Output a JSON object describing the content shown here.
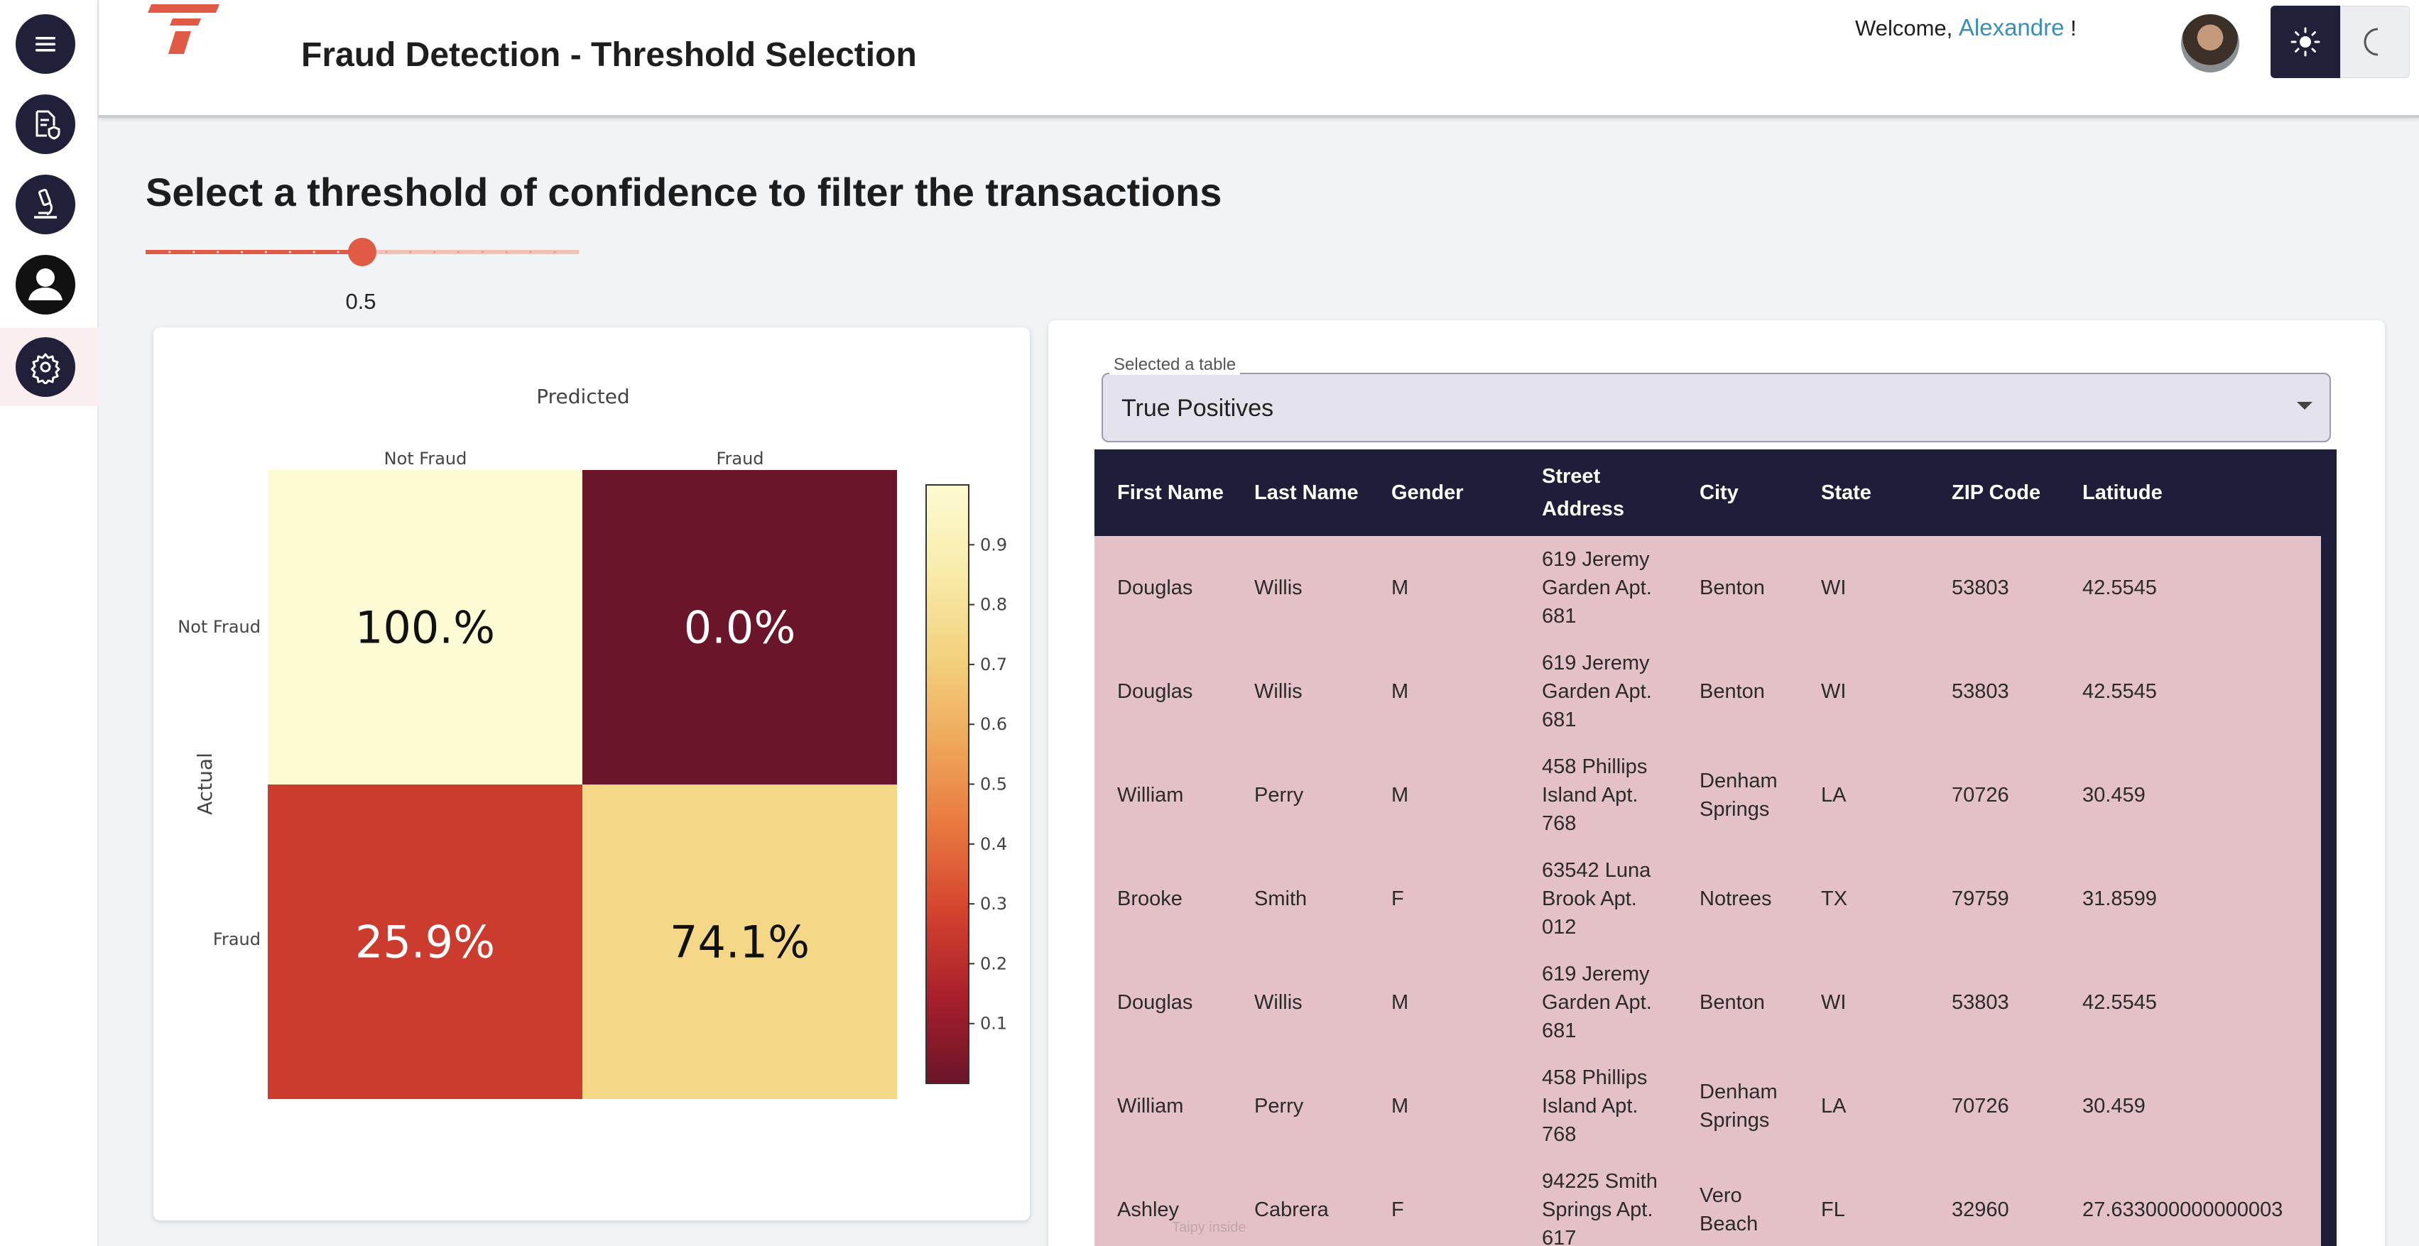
{
  "header": {
    "title": "Fraud Detection - Threshold Selection",
    "welcome_prefix": "Welcome,",
    "user_name": "Alexandre",
    "welcome_suffix": "!"
  },
  "sidebar": {
    "items": [
      {
        "icon": "menu-icon"
      },
      {
        "icon": "document-shield-icon"
      },
      {
        "icon": "microscope-icon"
      },
      {
        "icon": "user-icon"
      },
      {
        "icon": "gear-icon",
        "active": true
      }
    ]
  },
  "threshold": {
    "heading": "Select a threshold of confidence to filter the transactions",
    "value": "0.5",
    "value_fraction": 0.5,
    "accent": "#e05a45"
  },
  "chart_data": {
    "type": "heatmap",
    "title": "Predicted",
    "xlabel": "Predicted",
    "ylabel": "Actual",
    "x_categories": [
      "Not Fraud",
      "Fraud"
    ],
    "y_categories": [
      "Not Fraud",
      "Fraud"
    ],
    "values": [
      [
        1.0,
        0.0
      ],
      [
        0.259,
        0.741
      ]
    ],
    "cell_labels": [
      [
        "100.%",
        "0.0%"
      ],
      [
        "25.9%",
        "74.1%"
      ]
    ],
    "colorbar_ticks": [
      "0.9",
      "0.8",
      "0.7",
      "0.6",
      "0.5",
      "0.4",
      "0.3",
      "0.2",
      "0.1"
    ],
    "colorscale": [
      "#6a1529",
      "#a81f2c",
      "#d4432e",
      "#e8783f",
      "#f0a85a",
      "#f3d27f",
      "#f8ecaa",
      "#fdfbd3"
    ]
  },
  "table_select": {
    "label": "Selected a table",
    "value": "True Positives"
  },
  "table": {
    "columns": [
      "First Name",
      "Last Name",
      "Gender",
      "Street Address",
      "City",
      "State",
      "ZIP Code",
      "Latitude"
    ],
    "rows": [
      [
        "Douglas",
        "Willis",
        "M",
        "619 Jeremy Garden Apt. 681",
        "Benton",
        "WI",
        "53803",
        "42.5545"
      ],
      [
        "Douglas",
        "Willis",
        "M",
        "619 Jeremy Garden Apt. 681",
        "Benton",
        "WI",
        "53803",
        "42.5545"
      ],
      [
        "William",
        "Perry",
        "M",
        "458 Phillips Island Apt. 768",
        "Denham Springs",
        "LA",
        "70726",
        "30.459"
      ],
      [
        "Brooke",
        "Smith",
        "F",
        "63542 Luna Brook Apt. 012",
        "Notrees",
        "TX",
        "79759",
        "31.8599"
      ],
      [
        "Douglas",
        "Willis",
        "M",
        "619 Jeremy Garden Apt. 681",
        "Benton",
        "WI",
        "53803",
        "42.5545"
      ],
      [
        "William",
        "Perry",
        "M",
        "458 Phillips Island Apt. 768",
        "Denham Springs",
        "LA",
        "70726",
        "30.459"
      ],
      [
        "Ashley",
        "Cabrera",
        "F",
        "94225 Smith Springs Apt. 617",
        "Vero Beach",
        "FL",
        "32960",
        "27.633000000000003"
      ]
    ]
  },
  "watermark": "Taipy inside"
}
